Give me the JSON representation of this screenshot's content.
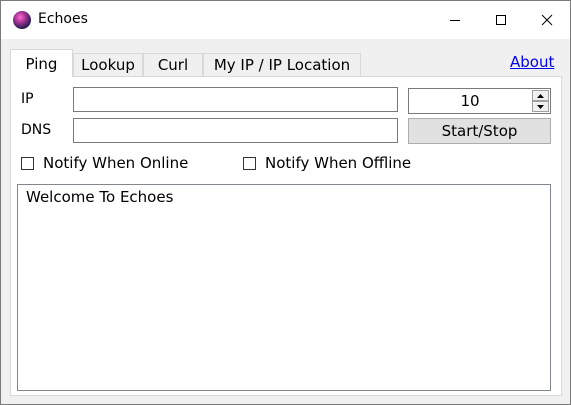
{
  "window": {
    "title": "Echoes"
  },
  "tabs": [
    {
      "label": "Ping",
      "active": true
    },
    {
      "label": "Lookup",
      "active": false
    },
    {
      "label": "Curl",
      "active": false
    },
    {
      "label": "My IP / IP Location",
      "active": false
    }
  ],
  "about_link": "About",
  "ping": {
    "ip_label": "IP",
    "ip_value": "",
    "dns_label": "DNS",
    "dns_value": "",
    "count_value": "10",
    "start_stop_label": "Start/Stop",
    "notify_online_label": "Notify When Online",
    "notify_online_checked": false,
    "notify_offline_label": "Notify When Offline",
    "notify_offline_checked": false,
    "log_text": "Welcome To Echoes"
  },
  "icons": {
    "app": "echoes-sphere-icon",
    "minimize": "minimize-icon",
    "maximize": "maximize-icon",
    "close": "close-icon",
    "spin_up": "arrow-up-icon",
    "spin_down": "arrow-down-icon"
  }
}
